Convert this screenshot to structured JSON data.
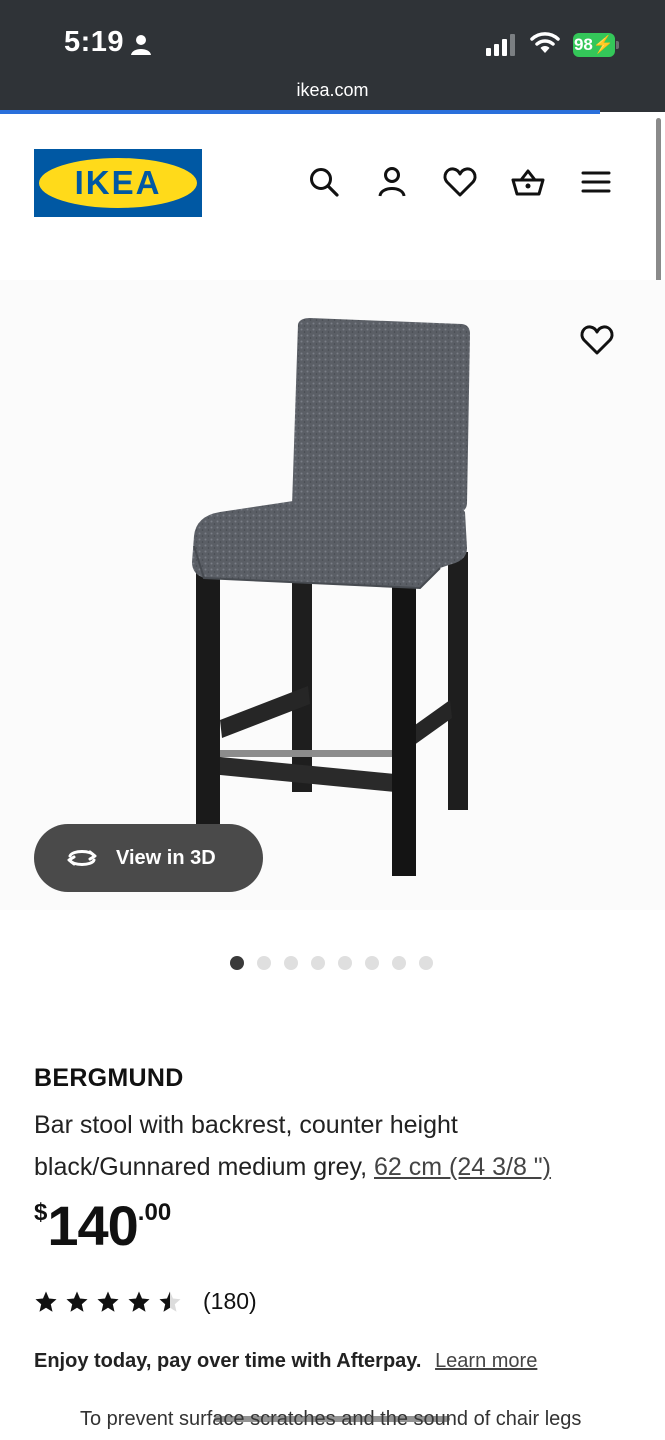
{
  "status_bar": {
    "time": "5:19",
    "battery": "98"
  },
  "browser": {
    "url": "ikea.com"
  },
  "header": {
    "logo_text": "IKEA",
    "icons": [
      "search-icon",
      "account-icon",
      "heart-icon",
      "basket-icon",
      "menu-icon"
    ]
  },
  "gallery": {
    "view3d_label": "View in 3D",
    "dot_count": 8,
    "active_index": 0
  },
  "product": {
    "name": "BERGMUND",
    "line1": "Bar stool with backrest, counter height",
    "line2_prefix": "black/Gunnared medium grey,",
    "measurement": "62 cm (24 3/8 \")",
    "price_currency": "$",
    "price_integer": "140",
    "price_decimals": ".00",
    "rating_value": 4.5,
    "review_count": "(180)"
  },
  "afterpay": {
    "text": "Enjoy today, pay over time with Afterpay.",
    "link": "Learn more"
  },
  "notice": "To prevent surface scratches and the sound of chair legs",
  "colors": {
    "ikea_blue": "#0058a3",
    "ikea_yellow": "#ffda1a",
    "battery_green": "#34c759"
  }
}
